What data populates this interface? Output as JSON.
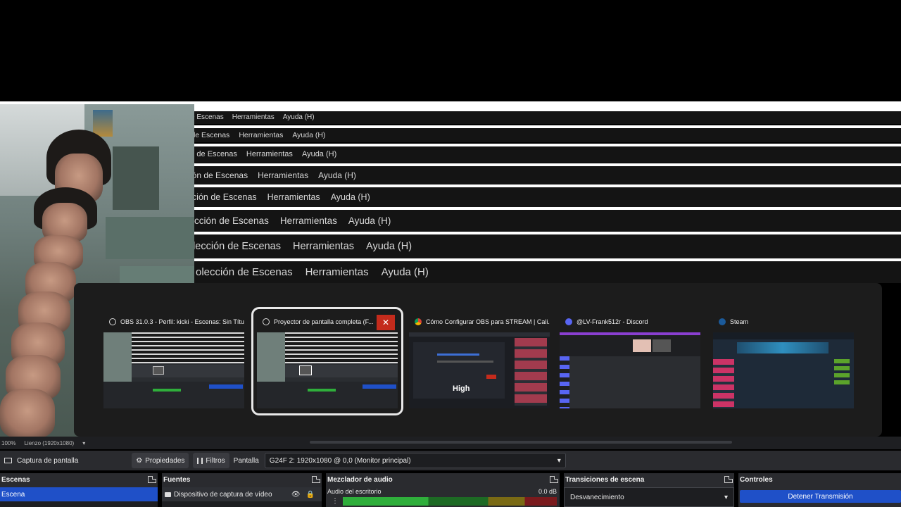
{
  "menubar": {
    "collection": "olección de Escenas",
    "tools": "Herramientas",
    "help": "Ayuda (H)"
  },
  "switcher": {
    "windows": [
      {
        "title": "OBS 31.0.3 - Perfil: kicki - Escenas: Sin Títu...",
        "icon": "obs-icon"
      },
      {
        "title": "Proyector de pantalla completa (F...",
        "icon": "obs-icon",
        "selected": true
      },
      {
        "title": "Cómo Configurar OBS para STREAM | Cali...",
        "icon": "chrome-icon"
      },
      {
        "title": "@LV-Frank512r - Discord",
        "icon": "discord-icon"
      },
      {
        "title": "Steam",
        "icon": "steam-icon"
      }
    ],
    "overlay_text": "High",
    "close_glyph": "✕"
  },
  "obs": {
    "status": {
      "zoom": "100%",
      "canvas": "Lienzo (1920x1080)"
    },
    "toolbar": {
      "source_name": "Captura de pantalla",
      "properties": "Propiedades",
      "filters": "Filtros",
      "display_label": "Pantalla",
      "display_value": "G24F 2: 1920x1080 @ 0,0 (Monitor principal)"
    },
    "docks": {
      "scenes": {
        "title": "Escenas",
        "items": [
          "Escena"
        ]
      },
      "sources": {
        "title": "Fuentes",
        "items": [
          "Dispositivo de captura de vídeo"
        ]
      },
      "mixer": {
        "title": "Mezclador de audio",
        "channel": "Audio del escritorio",
        "level": "0.0 dB"
      },
      "transitions": {
        "title": "Transiciones de escena",
        "value": "Desvanecimiento"
      },
      "controls": {
        "title": "Controles",
        "stop_stream": "Detener Transmisión"
      }
    }
  },
  "colors": {
    "accent": "#1f50c8",
    "close": "#c42b1c",
    "meter_green": "#2fae3b",
    "meter_yellow": "#b8a21a",
    "meter_red": "#b0262a"
  }
}
